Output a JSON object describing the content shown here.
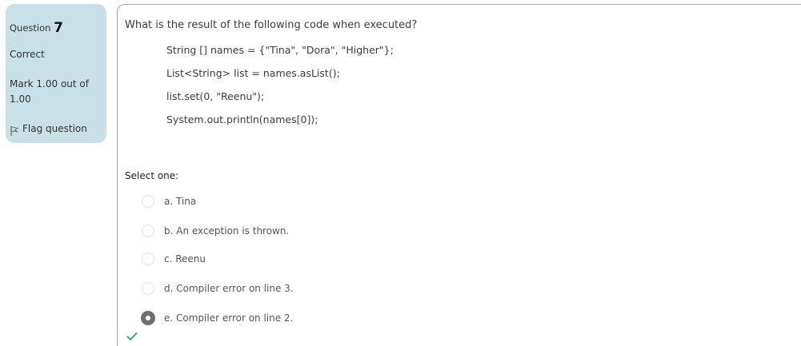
{
  "info": {
    "question_label": "Question",
    "question_number": "7",
    "state": "Correct",
    "grade": "Mark 1.00 out of 1.00",
    "flag_label": "Flag question"
  },
  "question": {
    "text": "What is the result of the following code when executed?",
    "code_lines": [
      "String [] names = {\"Tina\", \"Dora\", \"Higher\"};",
      "List<String> list = names.asList();",
      "list.set(0, \"Reenu\");",
      "System.out.println(names[0]);"
    ],
    "prompt": "Select one:",
    "options": [
      {
        "label": "a. Tina",
        "selected": false
      },
      {
        "label": "b. An exception is thrown.",
        "selected": false
      },
      {
        "label": "c. Reenu",
        "selected": false
      },
      {
        "label": "d. Compiler error on line 3.",
        "selected": false
      },
      {
        "label": "e. Compiler error on line 2.",
        "selected": true
      }
    ],
    "feedback_icon": "checkmark-icon"
  },
  "colors": {
    "info_panel_bg": "#c9e0e6",
    "correct_check": "#3fa66b",
    "selected_radio": "#6e6e6e"
  }
}
